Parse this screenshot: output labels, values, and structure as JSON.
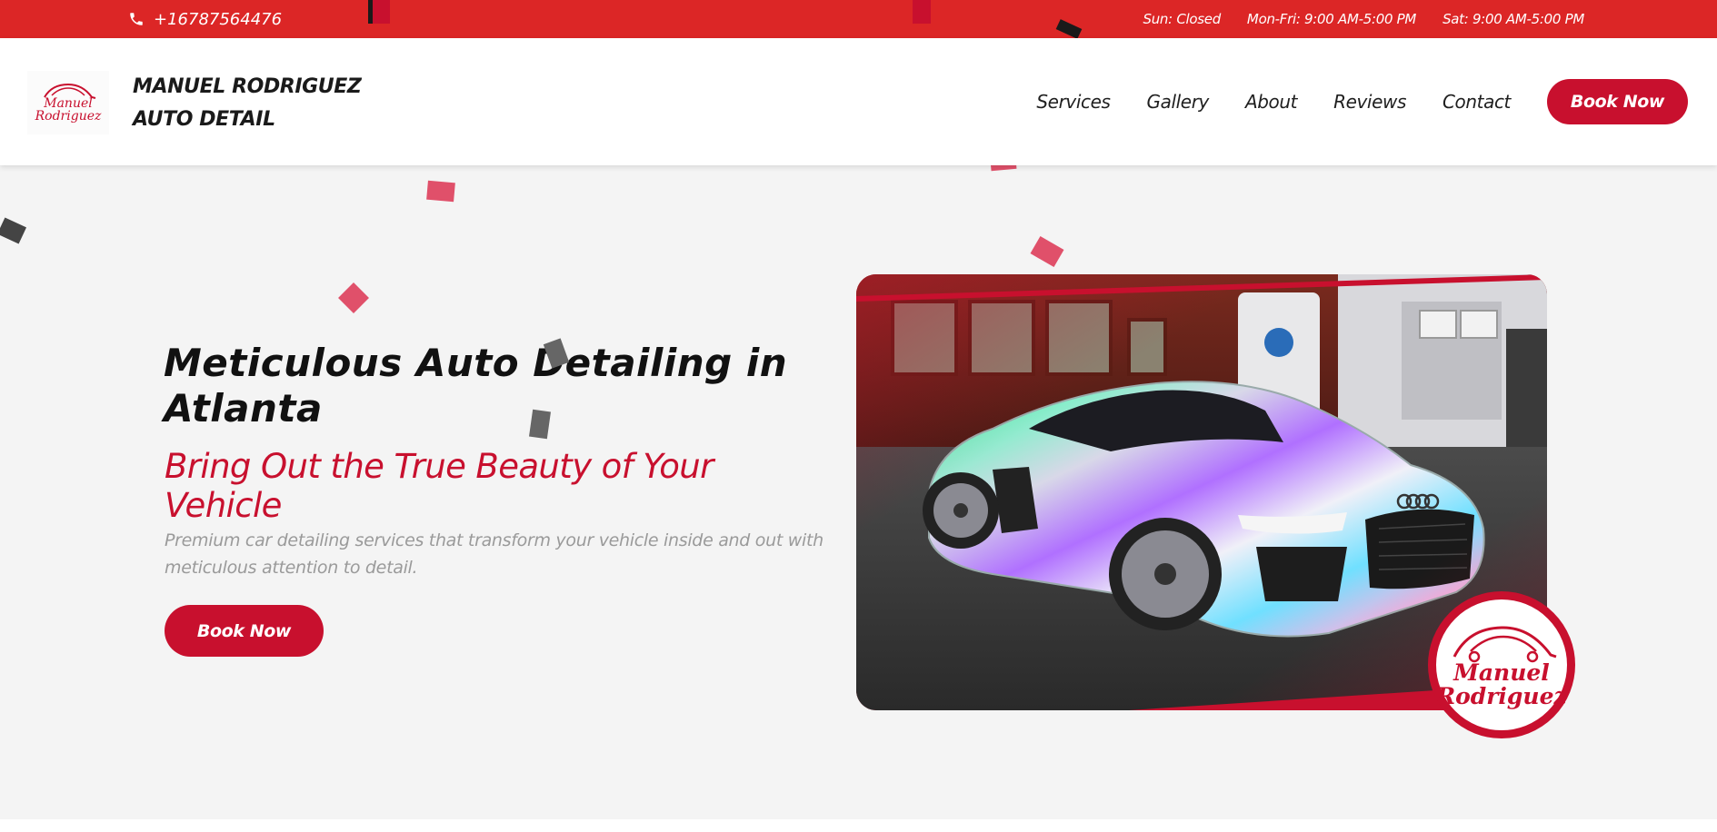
{
  "topbar": {
    "phone": "+16787564476",
    "hours": [
      "Sun: Closed",
      "Mon-Fri: 9:00 AM-5:00 PM",
      "Sat: 9:00 AM-5:00 PM"
    ]
  },
  "header": {
    "logo_text_line1": "Manuel",
    "logo_text_line2": "Rodriguez",
    "brand_line1": "MANUEL RODRIGUEZ",
    "brand_line2": "AUTO DETAIL",
    "nav": [
      "Services",
      "Gallery",
      "About",
      "Reviews",
      "Contact"
    ],
    "book_label": "Book Now"
  },
  "hero": {
    "title": "Meticulous Auto Detailing in Atlanta",
    "subtitle": "Bring Out the True Beauty of Your Vehicle",
    "description": "Premium car detailing services that transform your vehicle inside and out with meticulous attention to detail.",
    "book_label": "Book Now",
    "badge_line1": "Manuel",
    "badge_line2": "Rodriguez"
  },
  "colors": {
    "topbar": "#dc2626",
    "accent": "#c8102e",
    "background": "#f4f4f4"
  },
  "icons": [
    "phone-icon",
    "car-logo-icon"
  ]
}
